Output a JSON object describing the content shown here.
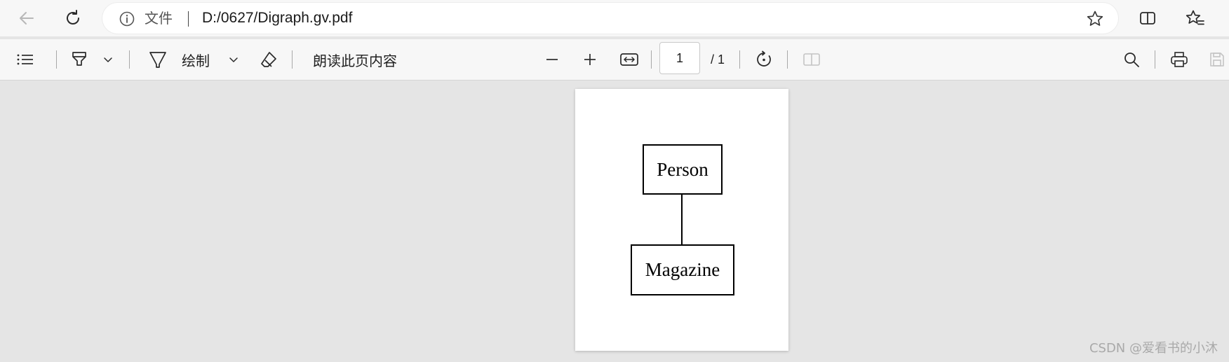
{
  "browser": {
    "address_bar": {
      "security_label": "文件",
      "url": "D:/0627/Digraph.gv.pdf"
    },
    "icons": {
      "back": "back-arrow-icon",
      "refresh": "refresh-icon",
      "info": "info-icon",
      "favorite": "star-icon",
      "split_screen": "split-screen-icon",
      "favorites_list": "favorites-icon"
    }
  },
  "pdf_toolbar": {
    "draw_label": "绘制",
    "read_aloud_label": "朗读此页内容",
    "current_page": "1",
    "total_pages": "/ 1",
    "icons": {
      "contents": "table-of-contents-icon",
      "highlight": "highlighter-icon",
      "draw": "pen-icon",
      "erase": "eraser-icon",
      "zoom_out": "minus-icon",
      "zoom_in": "plus-icon",
      "fit": "fit-to-width-icon",
      "rotate": "rotate-icon",
      "page_view": "page-view-icon",
      "search": "search-icon",
      "print": "print-icon",
      "save": "save-icon"
    }
  },
  "document": {
    "nodes": [
      {
        "label": "Person"
      },
      {
        "label": "Magazine"
      }
    ]
  },
  "watermark": "CSDN @爱看书的小沐"
}
